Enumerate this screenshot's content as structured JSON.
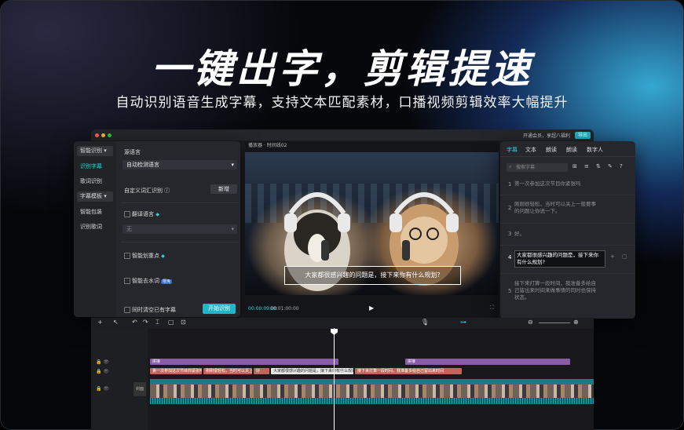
{
  "headline": "一键出字，剪辑提速",
  "subheadline": "自动识别语音生成字幕，支持文本匹配素材，口播视频剪辑效率大幅提升",
  "titlebar": {
    "export": "导出",
    "promo": "开通会员，享超八福利"
  },
  "left_nav": {
    "group1": "智能识别",
    "items": [
      "识别字幕",
      "歌词识别"
    ],
    "group2": "字幕模板",
    "items2": [
      "智能包装",
      "识别歌词"
    ]
  },
  "left_content": {
    "lang_label": "源语言",
    "lang_value": "自动检测语言",
    "vocab_label": "自定义词汇识别",
    "vocab_button": "新增",
    "translate_label": "翻译语言",
    "translate_value": "无",
    "highlight_label": "智能划重点",
    "filler_label": "智能去水词",
    "filler_badge": "限免",
    "clear_label": "同时清空已有字幕",
    "start_button": "开始识别"
  },
  "player": {
    "title": "播放器 · 时间线02",
    "subtitle": "大家都很感兴趣的问题是，接下来你有什么规划?",
    "time_current": "00:00:09:00",
    "time_total": "00:01:00:00"
  },
  "right_panel": {
    "tabs": [
      "字幕",
      "文本",
      "朗读",
      "朗读",
      "数字人"
    ],
    "search_placeholder": "搜索字幕",
    "rows": [
      {
        "num": "1",
        "text": "第一次参加这次节目你紧张吗"
      },
      {
        "num": "2",
        "text": "刚刚很轻松，当时可以关上一般要事的问题让你说一下。"
      },
      {
        "num": "3",
        "text": "好。"
      },
      {
        "num": "4",
        "text": "大家都很感兴趣的问题是，接下来你有什么规划?"
      },
      {
        "num": "5",
        "text": "接下来打算一段时间，我准备多给自己留出来时间来做事情的同时也保持状态。"
      }
    ]
  },
  "timeline": {
    "text_clip1": "拼接",
    "text_clip2": "拼接",
    "subtitle_clips": [
      "第一次参加这次节目你紧张吗",
      "刚刚很轻松，当时可以关上",
      "好",
      "大家都很感兴趣的问题是，接下来你有什么规划",
      "接下来打算一段时间，我准备多给自己留出来时间"
    ],
    "cover_label": "封面",
    "video_label": "画面"
  },
  "colors": {
    "accent": "#1fb6c9",
    "panel": "#26272c",
    "purple": "#8a5ca6",
    "red": "#c1655c"
  }
}
